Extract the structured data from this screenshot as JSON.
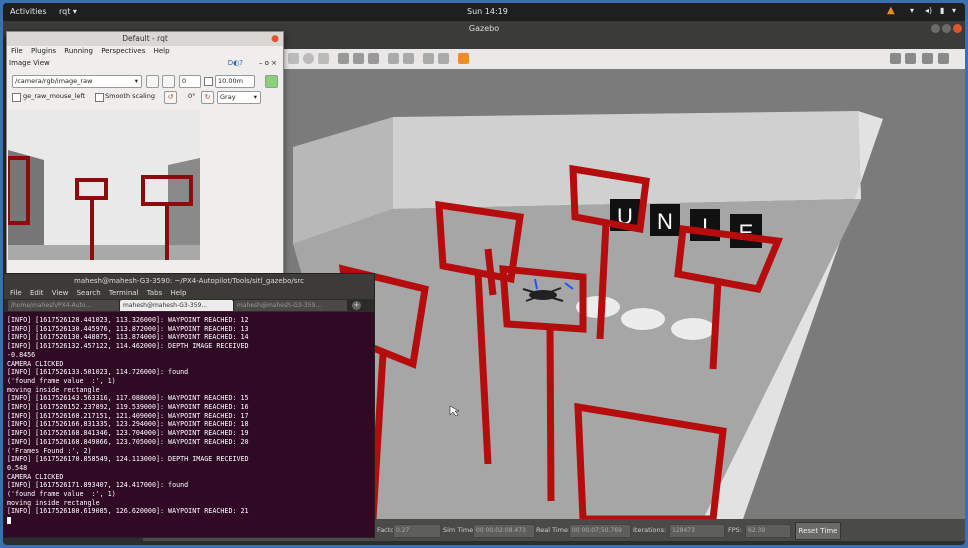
{
  "topbar": {
    "activities": "Activities",
    "app_menu": "rqt ▾",
    "clock": "Sun 14:19"
  },
  "gazebo": {
    "window_title": "Gazebo",
    "status": {
      "factor_label": "Real Time Factor:",
      "factor_value": "0.27",
      "sim_time_label": "Sim Time:",
      "sim_time_value": "00 00:02:08.473",
      "real_time_label": "Real Time:",
      "real_time_value": "00 00:07:50.769",
      "iterations_label": "Iterations:",
      "iterations_value": "128473",
      "fps_label": "FPS:",
      "fps_value": "62.39",
      "reset_label": "Reset Time"
    },
    "sign_letters": [
      "U",
      "N",
      "I",
      "E"
    ],
    "frame_color": "#b50d0d"
  },
  "rqt": {
    "title": "Default - rqt",
    "menu": [
      "File",
      "Plugins",
      "Running",
      "Perspectives",
      "Help"
    ],
    "plugin_title": "Image View",
    "topic": "/camera/rgb/image_raw",
    "spin_value": "0",
    "range_value": "10.00m",
    "mouse_topic": "ge_raw_mouse_left",
    "smooth_label": "Smooth scaling",
    "rotation": "0°",
    "color_scheme": "Gray"
  },
  "terminal": {
    "title": "mahesh@mahesh-G3-3590: ~/PX4-Autopilot/Tools/sitl_gazebo/src",
    "menu": [
      "File",
      "Edit",
      "View",
      "Search",
      "Terminal",
      "Tabs",
      "Help"
    ],
    "tabs": [
      "/home/mahesh/PX4-Auto...",
      "mahesh@mahesh-G3-359...",
      "mahesh@mahesh-G3-359..."
    ],
    "lines": [
      "[INFO] [1617526128.441023, 113.326000]: WAYPOINT REACHED: 12",
      "[INFO] [1617526130.445976, 113.872000]: WAYPOINT REACHED: 13",
      "[INFO] [1617526130.448875, 113.874000]: WAYPOINT REACHED: 14",
      "[INFO] [1617526132.457122, 114.462000]: DEPTH IMAGE RECEIVED",
      "-0.8456",
      "CAMERA CLICKED",
      "[INFO] [1617526133.501023, 114.726000]: found",
      "('found frame value  :', 1)",
      "moving inside rectangle",
      "[INFO] [1617526143.563316, 117.088000]: WAYPOINT REACHED: 15",
      "[INFO] [1617526152.237892, 119.539000]: WAYPOINT REACHED: 16",
      "[INFO] [1617526160.217151, 121.409000]: WAYPOINT REACHED: 17",
      "[INFO] [1617526166.831335, 123.294000]: WAYPOINT REACHED: 18",
      "[INFO] [1617526168.841346, 123.704000]: WAYPOINT REACHED: 19",
      "[INFO] [1617526168.849866, 123.705000]: WAYPOINT REACHED: 20",
      "('Frames Found :', 2)",
      "[INFO] [1617526170.858549, 124.113000]: DEPTH IMAGE RECEIVED",
      "0.548",
      "CAMERA CLICKED",
      "[INFO] [1617526171.893407, 124.417000]: found",
      "('found frame value  :', 1)",
      "moving inside rectangle",
      "[INFO] [1617526180.619085, 126.620000]: WAYPOINT REACHED: 21"
    ]
  }
}
